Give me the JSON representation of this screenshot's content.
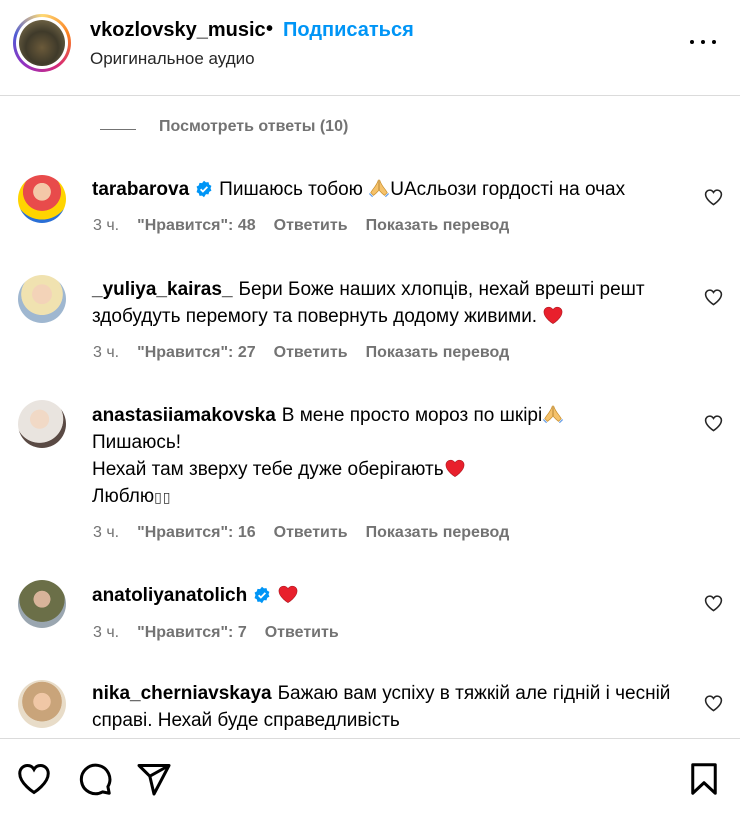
{
  "header": {
    "username": "vkozlovsky_music",
    "separator": "•",
    "follow_label": "Подписаться",
    "subtitle": "Оригинальное аудио",
    "more_icon": "more-horizontal-icon"
  },
  "view_replies": "Посмотреть ответы (10)",
  "comments": [
    {
      "username": "tarabarova",
      "verified": true,
      "text_a": "Пишаюсь тобою ",
      "text_b": "UAсльози гордості на очах",
      "time": "3 ч.",
      "likes": "\"Нравится\": 48",
      "reply": "Ответить",
      "translate": "Показать перевод"
    },
    {
      "username": "_yuliya_kairas_",
      "verified": false,
      "text": "Бери Боже наших хлопців, нехай врешті решт здобудуть перемогу та повернуть додому живими.",
      "time": "3 ч.",
      "likes": "\"Нравится\": 27",
      "reply": "Ответить",
      "translate": "Показать перевод"
    },
    {
      "username": "anastasiiamakovska",
      "verified": false,
      "line1": "В мене просто мороз по шкірі",
      "line2": "Пишаюсь!",
      "line3": "Нехай там зверху тебе дуже оберігають",
      "line4": "Люблю",
      "line4_glyphs": "▯▯",
      "time": "3 ч.",
      "likes": "\"Нравится\": 16",
      "reply": "Ответить",
      "translate": "Показать перевод"
    },
    {
      "username": "anatoliyanatolich",
      "verified": true,
      "time": "3 ч.",
      "likes": "\"Нравится\": 7",
      "reply": "Ответить"
    },
    {
      "username": "nika_cherniavskaya",
      "verified": false,
      "text": "Бажаю вам успіху в тяжкій але гідній і чесній справі. Нехай буде справедливість"
    }
  ],
  "footer": {
    "icons": [
      "heart-icon",
      "comment-icon",
      "share-icon",
      "bookmark-icon"
    ]
  },
  "colors": {
    "accent": "#0095f6",
    "muted": "#737373",
    "like_red": "#ff3040",
    "verified": "#0095f6"
  }
}
